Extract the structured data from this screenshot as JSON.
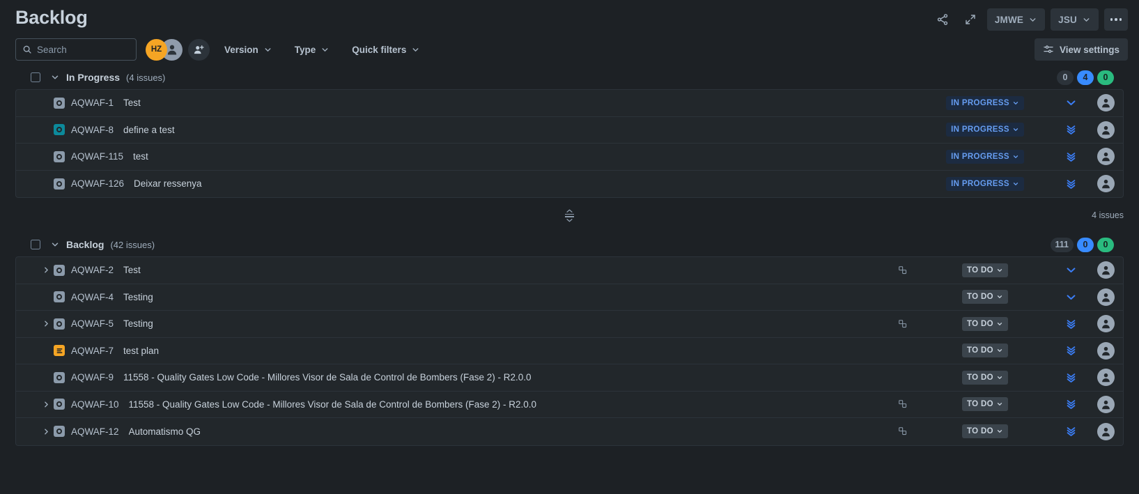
{
  "header": {
    "title": "Backlog",
    "share_icon": "share-icon",
    "expand_icon": "expand-icon",
    "board_button": {
      "label": "JMWE",
      "chevron": "chevron-down-icon"
    },
    "project_button": {
      "label": "JSU",
      "chevron": "chevron-down-icon"
    },
    "more_button": "more-actions-icon"
  },
  "toolbar": {
    "search": {
      "placeholder": "Search",
      "value": "",
      "icon": "search-icon"
    },
    "avatars": [
      {
        "initials": "HZ",
        "name": "avatar-hz"
      },
      {
        "initials": "",
        "name": "avatar-person"
      }
    ],
    "add_people": "add-person-icon",
    "filters": [
      {
        "label": "Version",
        "chevron": "chevron-down-icon"
      },
      {
        "label": "Type",
        "chevron": "chevron-down-icon"
      },
      {
        "label": "Quick filters",
        "chevron": "chevron-down-icon"
      }
    ],
    "view_settings": {
      "label": "View settings",
      "icon": "sliders-icon"
    }
  },
  "sections": [
    {
      "id": "in-progress",
      "name": "In Progress",
      "count_label": "(4 issues)",
      "badges": [
        {
          "value": "0",
          "color": "#2c333a",
          "style": "grey"
        },
        {
          "value": "4",
          "color": "#388bff",
          "style": "blue"
        },
        {
          "value": "0",
          "color": "#2abb7f",
          "style": "green"
        }
      ],
      "footer_total": "4 issues",
      "issues": [
        {
          "expand": false,
          "type_icon": "story-icon",
          "type_color": "#8c9bab",
          "key": "AQWAF-1",
          "summary": "Test",
          "has_children_icon": false,
          "status": "IN PROGRESS",
          "status_style": "inprogress",
          "priority": "medium-priority-icon",
          "assignee": "unassigned-avatar"
        },
        {
          "expand": false,
          "type_icon": "story-icon",
          "type_color": "#0c8a9b",
          "key": "AQWAF-8",
          "summary": "define a test",
          "has_children_icon": false,
          "status": "IN PROGRESS",
          "status_style": "inprogress",
          "priority": "lowest-priority-icon",
          "assignee": "unassigned-avatar"
        },
        {
          "expand": false,
          "type_icon": "story-icon",
          "type_color": "#8c9bab",
          "key": "AQWAF-115",
          "summary": "test",
          "has_children_icon": false,
          "status": "IN PROGRESS",
          "status_style": "inprogress",
          "priority": "lowest-priority-icon",
          "assignee": "unassigned-avatar"
        },
        {
          "expand": false,
          "type_icon": "story-icon",
          "type_color": "#8c9bab",
          "key": "AQWAF-126",
          "summary": "Deixar ressenya",
          "has_children_icon": false,
          "status": "IN PROGRESS",
          "status_style": "inprogress",
          "priority": "lowest-priority-icon",
          "assignee": "unassigned-avatar"
        }
      ]
    },
    {
      "id": "backlog",
      "name": "Backlog",
      "count_label": "(42 issues)",
      "badges": [
        {
          "value": "111",
          "color": "#2c333a",
          "style": "grey"
        },
        {
          "value": "0",
          "color": "#388bff",
          "style": "blue"
        },
        {
          "value": "0",
          "color": "#2abb7f",
          "style": "green"
        }
      ],
      "footer_total": "",
      "issues": [
        {
          "expand": true,
          "type_icon": "story-icon",
          "type_color": "#8c9bab",
          "key": "AQWAF-2",
          "summary": "Test",
          "has_children_icon": true,
          "status": "TO DO",
          "status_style": "todo",
          "priority": "medium-priority-icon",
          "assignee": "unassigned-avatar"
        },
        {
          "expand": false,
          "type_icon": "story-icon",
          "type_color": "#8c9bab",
          "key": "AQWAF-4",
          "summary": "Testing",
          "has_children_icon": false,
          "status": "TO DO",
          "status_style": "todo",
          "priority": "medium-priority-icon",
          "assignee": "unassigned-avatar"
        },
        {
          "expand": true,
          "type_icon": "story-icon",
          "type_color": "#8c9bab",
          "key": "AQWAF-5",
          "summary": "Testing",
          "has_children_icon": true,
          "status": "TO DO",
          "status_style": "todo",
          "priority": "lowest-priority-icon",
          "assignee": "unassigned-avatar"
        },
        {
          "expand": false,
          "type_icon": "task-icon",
          "type_color": "#f5a524",
          "key": "AQWAF-7",
          "summary": "test plan",
          "has_children_icon": false,
          "status": "TO DO",
          "status_style": "todo",
          "priority": "lowest-priority-icon",
          "assignee": "unassigned-avatar"
        },
        {
          "expand": false,
          "type_icon": "story-icon",
          "type_color": "#8c9bab",
          "key": "AQWAF-9",
          "summary": "11558 - Quality Gates Low Code - Millores Visor de Sala de Control de Bombers (Fase 2) - R2.0.0",
          "has_children_icon": false,
          "status": "TO DO",
          "status_style": "todo",
          "priority": "lowest-priority-icon",
          "assignee": "unassigned-avatar"
        },
        {
          "expand": true,
          "type_icon": "story-icon",
          "type_color": "#8c9bab",
          "key": "AQWAF-10",
          "summary": "11558 - Quality Gates Low Code - Millores Visor de Sala de Control de Bombers (Fase 2) - R2.0.0",
          "has_children_icon": true,
          "status": "TO DO",
          "status_style": "todo",
          "priority": "lowest-priority-icon",
          "assignee": "unassigned-avatar"
        },
        {
          "expand": true,
          "type_icon": "story-icon",
          "type_color": "#8c9bab",
          "key": "AQWAF-12",
          "summary": "Automatismo QG",
          "has_children_icon": true,
          "status": "TO DO",
          "status_style": "todo",
          "priority": "lowest-priority-icon",
          "assignee": "unassigned-avatar"
        }
      ]
    }
  ],
  "colors": {
    "background": "#1d2125",
    "row_background": "#22272b",
    "accent_blue": "#388bff",
    "accent_green": "#2abb7f",
    "orange": "#f5a524",
    "teal": "#0c8a9b"
  }
}
